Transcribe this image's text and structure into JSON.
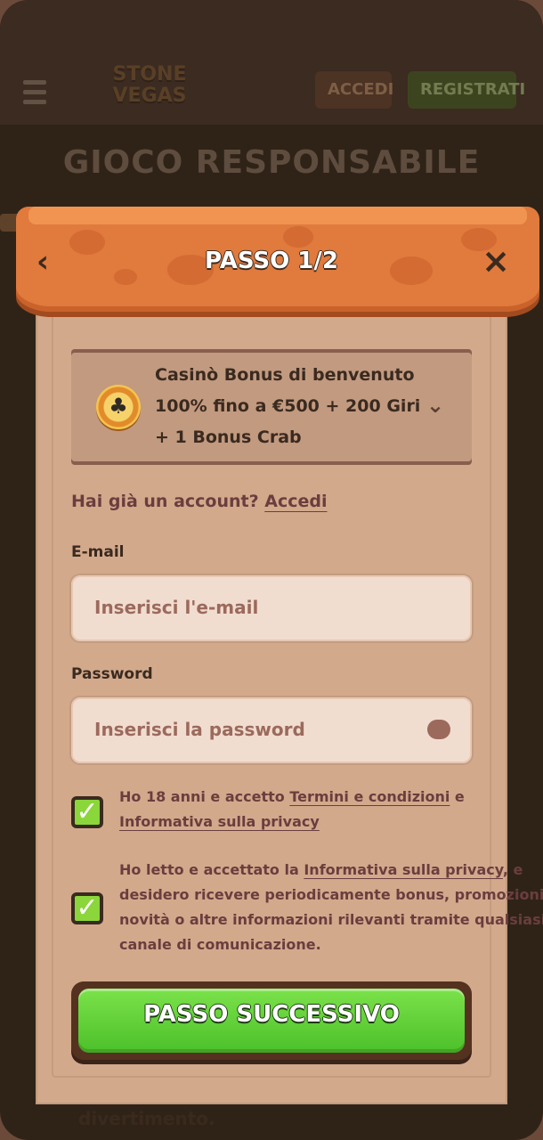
{
  "background": {
    "logo_line1": "STONE",
    "logo_line2": "VEGAS",
    "login_label": "ACCEDI",
    "register_label": "REGISTRATI",
    "page_title": "GIOCO RESPONSABILE",
    "bottom_text": "divertimento."
  },
  "modal": {
    "title": "PASSO 1/2",
    "bonus": {
      "line1": "Casinò Bonus di benvenuto",
      "line2": "100% fino a €500 + 200  Giri",
      "line3": "+  1  Bonus  Crab"
    },
    "account_prompt": "Hai già un account?",
    "account_link": "Accedi",
    "email": {
      "label": "E-mail",
      "placeholder": "Inserisci l'e-mail"
    },
    "password": {
      "label": "Password",
      "placeholder": "Inserisci la password"
    },
    "consents": {
      "age": {
        "prefix": "Ho 18 anni e accetto ",
        "terms_link": "Termini e condizioni",
        "suffix": " e",
        "privacy_link": "Informativa sulla privacy",
        "checked": true
      },
      "marketing": {
        "prefix": "Ho letto e accettato la ",
        "privacy_link": "Informativa sulla privacy",
        "suffix": ", e",
        "line2": "desidero ricevere periodicamente bonus, promozioni,",
        "line3": "novità o altre informazioni rilevanti tramite qualsiasi",
        "line4": "canale di comunicazione.",
        "checked": true
      }
    },
    "next_button": "PASSO SUCCESSIVO"
  }
}
